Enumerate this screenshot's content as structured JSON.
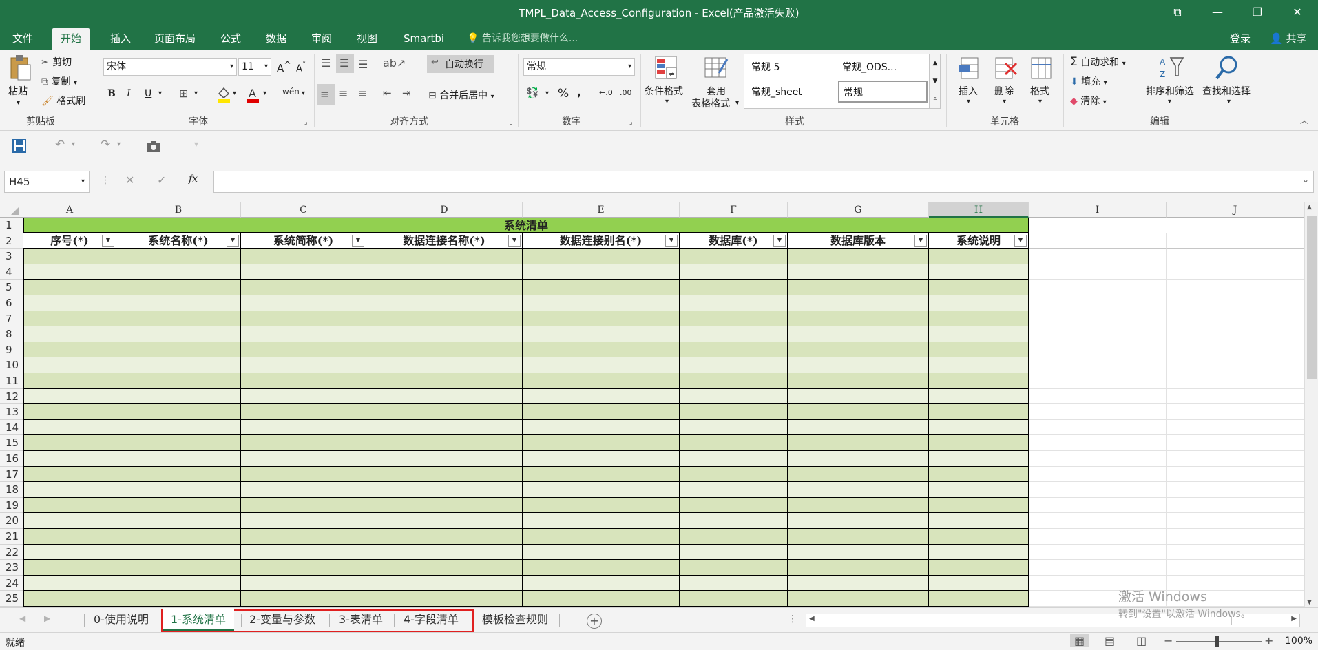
{
  "window": {
    "title": "TMPL_Data_Access_Configuration - Excel(产品激活失败)",
    "controls": {
      "ribbon_options": "⧉",
      "minimize": "—",
      "restore": "❐",
      "close": "✕"
    }
  },
  "ribbon_tabs": [
    "文件",
    "开始",
    "插入",
    "页面布局",
    "公式",
    "数据",
    "审阅",
    "视图",
    "Smartbi"
  ],
  "active_tab": "开始",
  "tell_me": "告诉我您想要做什么...",
  "account": {
    "login": "登录",
    "share": "共享"
  },
  "clipboard": {
    "paste": "粘贴",
    "cut": "剪切",
    "copy": "复制",
    "format_painter": "格式刷",
    "label": "剪贴板"
  },
  "font": {
    "name": "宋体",
    "size": "11",
    "bold": "B",
    "italic": "I",
    "underline": "U",
    "phonetic": "wén",
    "label": "字体"
  },
  "alignment": {
    "wrap_text": "自动换行",
    "merge_center": "合并后居中",
    "label": "对齐方式"
  },
  "number": {
    "format": "常规",
    "percent": "%",
    "comma": ",",
    "inc_decimal": ".00",
    "label": "数字"
  },
  "styles": {
    "conditional": "条件格式",
    "table_format_1": "套用",
    "table_format_2": "表格格式",
    "items": [
      "常规 5",
      "常规_ODS...",
      "常规_sheet",
      "常规"
    ],
    "label": "样式"
  },
  "cells_group": {
    "insert": "插入",
    "delete": "删除",
    "format": "格式",
    "label": "单元格"
  },
  "editing": {
    "autosum": "自动求和",
    "fill": "填充",
    "clear": "清除",
    "sort_filter": "排序和筛选",
    "find_select": "查找和选择",
    "label": "编辑"
  },
  "formula_bar": {
    "name_box": "H45",
    "fx": "fx",
    "value": ""
  },
  "columns": [
    "A",
    "B",
    "C",
    "D",
    "E",
    "F",
    "G",
    "H",
    "I",
    "J"
  ],
  "selected_column": "H",
  "sheet": {
    "title": "系统清单",
    "headers": [
      "序号(*)",
      "系统名称(*)",
      "系统简称(*)",
      "数据连接名称(*)",
      "数据连接别名(*)",
      "数据库(*)",
      "数据库版本",
      "系统说明"
    ],
    "rows": [
      "1",
      "2",
      "3",
      "4",
      "5",
      "6",
      "7",
      "8",
      "9",
      "10",
      "11",
      "12",
      "13",
      "14",
      "15",
      "16",
      "17",
      "18",
      "19",
      "20",
      "21",
      "22",
      "23",
      "24",
      "25"
    ],
    "header_fill": "#92d050",
    "body_fill_dark": "#d8e4bc",
    "body_fill_light": "#ebf1de"
  },
  "sheet_tabs": [
    "0-使用说明",
    "1-系统清单",
    "2-变量与参数",
    "3-表清单",
    "4-字段清单",
    "模板检查规则"
  ],
  "active_sheet": "1-系统清单",
  "status": {
    "ready": "就绪",
    "zoom": "100%"
  },
  "watermark": {
    "line1": "激活 Windows",
    "line2": "转到\"设置\"以激活 Windows。"
  },
  "colors": {
    "excel_green": "#217346",
    "highlight_border": "#e02020"
  }
}
